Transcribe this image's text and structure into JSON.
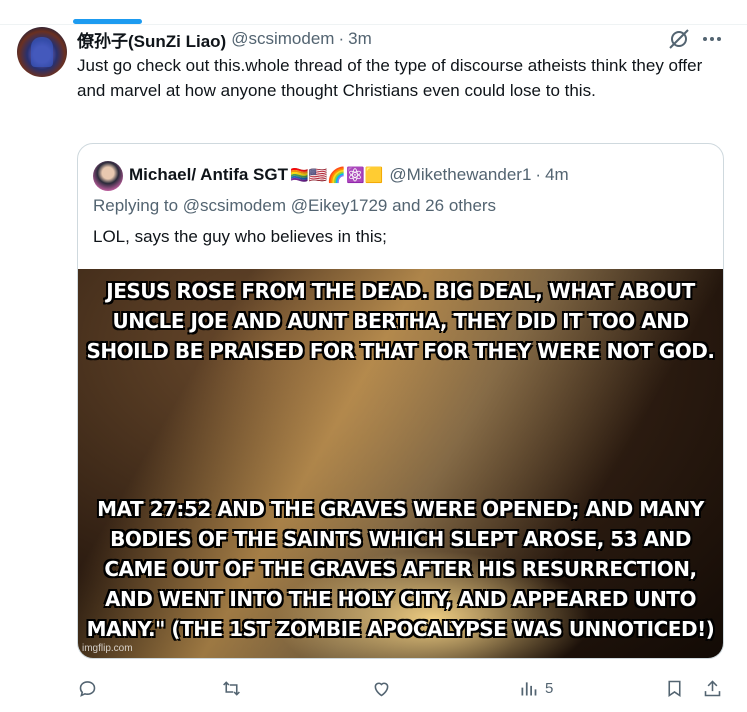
{
  "tweet": {
    "name": "僚孙子(SunZi Liao)",
    "handle": "@scsimodem",
    "separator": "·",
    "time": "3m",
    "text": "Just go check out this.whole thread of the type of discourse atheists think they offer and marvel at how anyone thought Christians even could lose to this."
  },
  "quote": {
    "name": "Michael/ Antifa SGT",
    "emojis": "🏳️‍🌈🇺🇸🌈⚛️🟨",
    "handle": "@Mikethewander1",
    "separator": "·",
    "time": "4m",
    "replying_prefix": "Replying to ",
    "replying_targets": "@scsimodem @Eikey1729 and 26 others",
    "text": "LOL, says the guy who believes in this;",
    "meme": {
      "top_text": "JESUS ROSE FROM THE DEAD. BIG DEAL, WHAT ABOUT UNCLE JOE AND AUNT BERTHA, THEY DID IT TOO AND SHOILD BE PRAISED FOR THAT FOR THEY WERE NOT GOD.",
      "bottom_text": "MAT 27:52 AND THE GRAVES WERE OPENED; AND MANY BODIES OF THE SAINTS WHICH SLEPT AROSE, 53 AND CAME OUT OF THE GRAVES AFTER HIS RESURRECTION, AND WENT INTO THE HOLY CITY, AND APPEARED UNTO MANY.\" (THE 1ST ZOMBIE APOCALYPSE WAS UNNOTICED!)",
      "watermark": "imgflip.com"
    }
  },
  "actions": {
    "views_count": "5",
    "icons": [
      "reply-icon",
      "retweet-icon",
      "like-icon",
      "views-icon",
      "bookmark-icon",
      "share-icon"
    ]
  },
  "colors": {
    "accent": "#1d9bf0",
    "secondary_text": "#536471",
    "border": "#cfd9de"
  }
}
